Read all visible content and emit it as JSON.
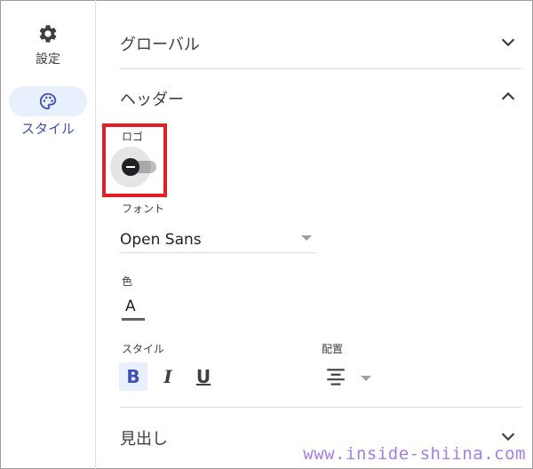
{
  "rail": {
    "settings_label": "設定",
    "style_label": "スタイル"
  },
  "sections": {
    "global_title": "グローバル",
    "header_title": "ヘッダー",
    "heading_title": "見出し"
  },
  "header": {
    "logo_label": "ロゴ",
    "logo_toggle_on": false,
    "font_label": "フォント",
    "font_value": "Open Sans",
    "color_label": "色",
    "color_letter": "A",
    "style_label": "スタイル",
    "bold_label": "B",
    "italic_label": "I",
    "underline_label": "U",
    "align_label": "配置"
  },
  "colors": {
    "accent": "#3f51b5",
    "highlight": "#e31e24",
    "watermark": "#a37ee8"
  },
  "watermark": "www.inside-shiina.com"
}
